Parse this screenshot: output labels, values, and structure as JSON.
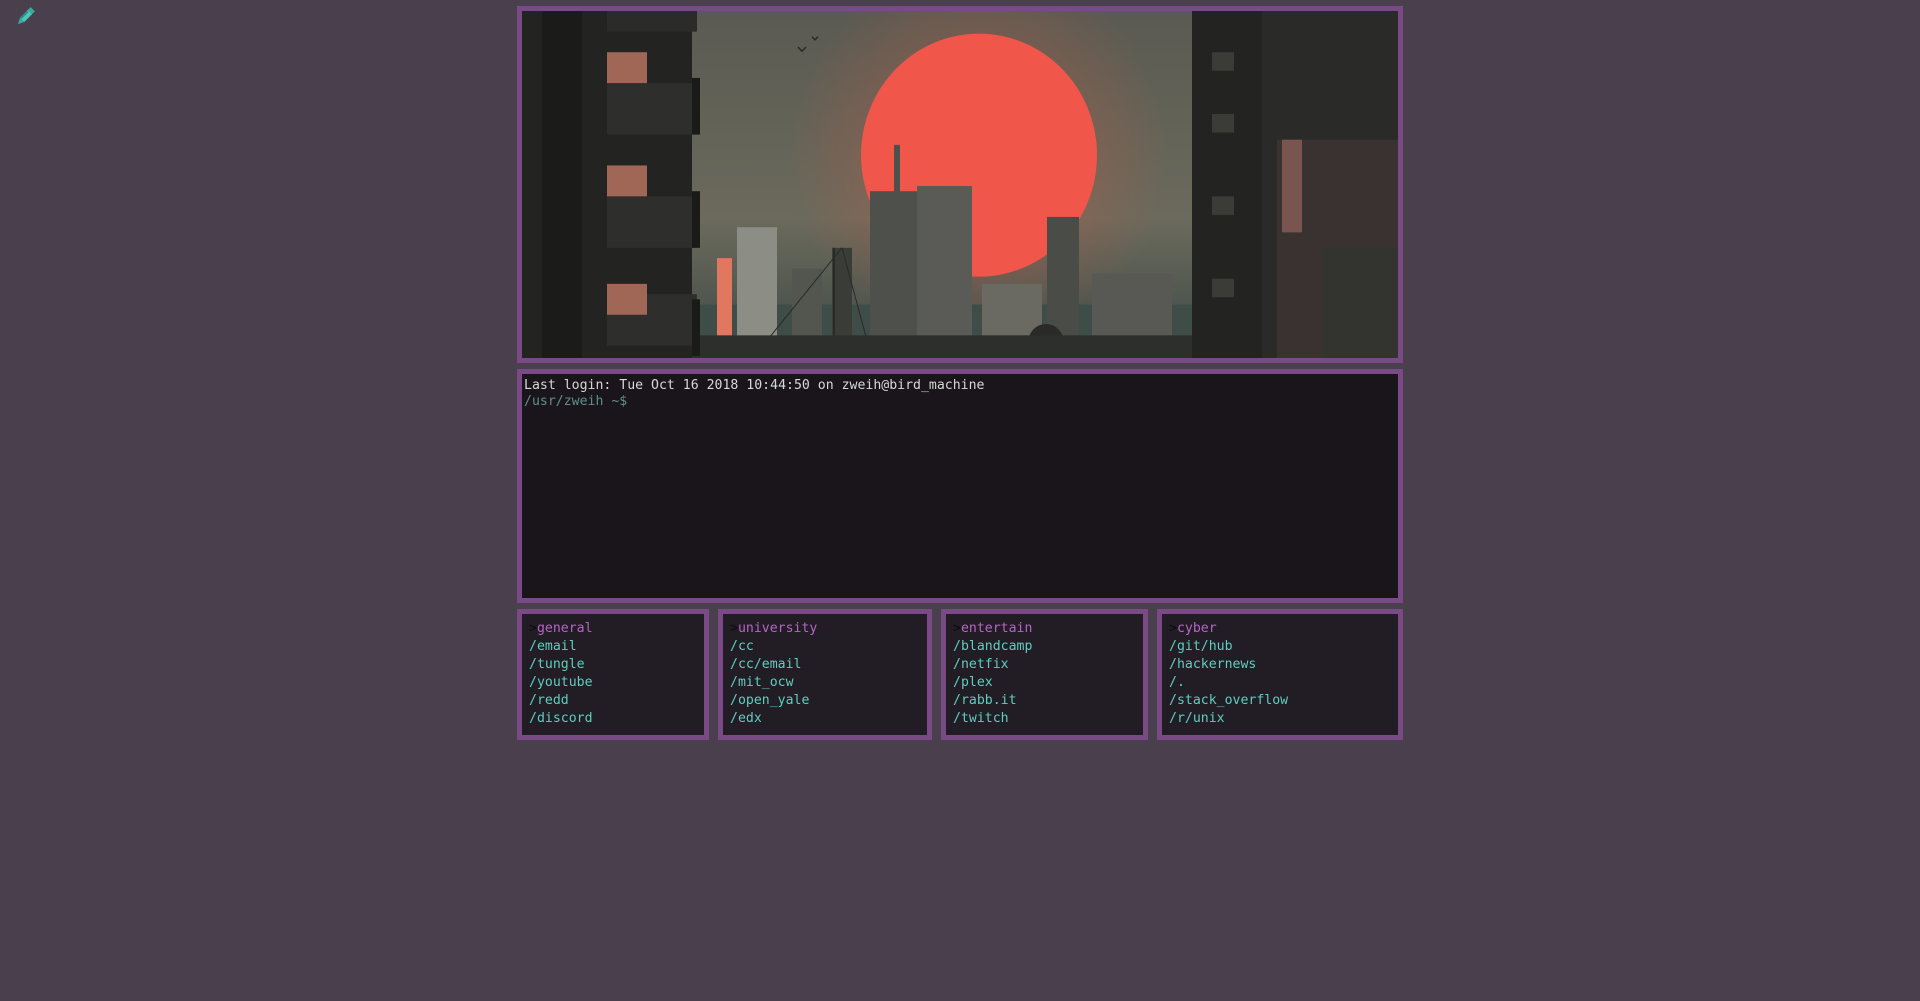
{
  "edit_icon": "pencil-icon",
  "terminal": {
    "last_login": "Last login: Tue Oct 16 2018 10:44:50 on zweih@bird_machine",
    "prompt": "/usr/zweih ~$"
  },
  "colors": {
    "background": "#4a3f4d",
    "border": "#7a4a86",
    "panel": "#19151b",
    "link": "#5ccfc0",
    "heading": "#b565c6",
    "sun": "#f0564a"
  },
  "groups": [
    {
      "chevron": ">",
      "title": "general",
      "links": [
        "/email",
        "/tungle",
        "/youtube",
        "/redd",
        "/discord"
      ]
    },
    {
      "chevron": ">",
      "title": "university",
      "links": [
        "/cc",
        "/cc/email",
        "/mit_ocw",
        "/open_yale",
        "/edx"
      ]
    },
    {
      "chevron": ">",
      "title": "entertain",
      "links": [
        "/blandcamp",
        "/netfix",
        "/plex",
        "/rabb.it",
        "/twitch"
      ]
    },
    {
      "chevron": ">",
      "title": "cyber",
      "links": [
        "/git/hub",
        "/hackernews",
        "/.",
        "/stack_overflow",
        "/r/unix"
      ]
    }
  ]
}
